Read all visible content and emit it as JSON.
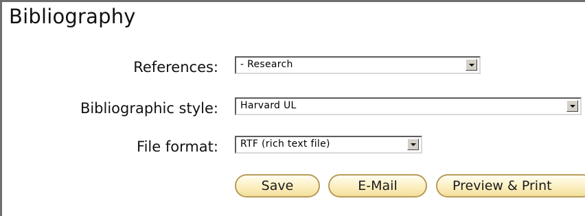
{
  "panel": {
    "title": "Bibliography"
  },
  "form": {
    "references": {
      "label": "References:",
      "value": "- Research"
    },
    "style": {
      "label": "Bibliographic style:",
      "value": "Harvard UL"
    },
    "format": {
      "label": "File format:",
      "value": "RTF (rich text file)"
    }
  },
  "actions": {
    "save": "Save",
    "email": "E-Mail",
    "preview": "Preview & Print"
  },
  "colors": {
    "button_fill": "#fcefc0",
    "button_border": "#b89a55",
    "panel_border": "#6e6e6e"
  }
}
